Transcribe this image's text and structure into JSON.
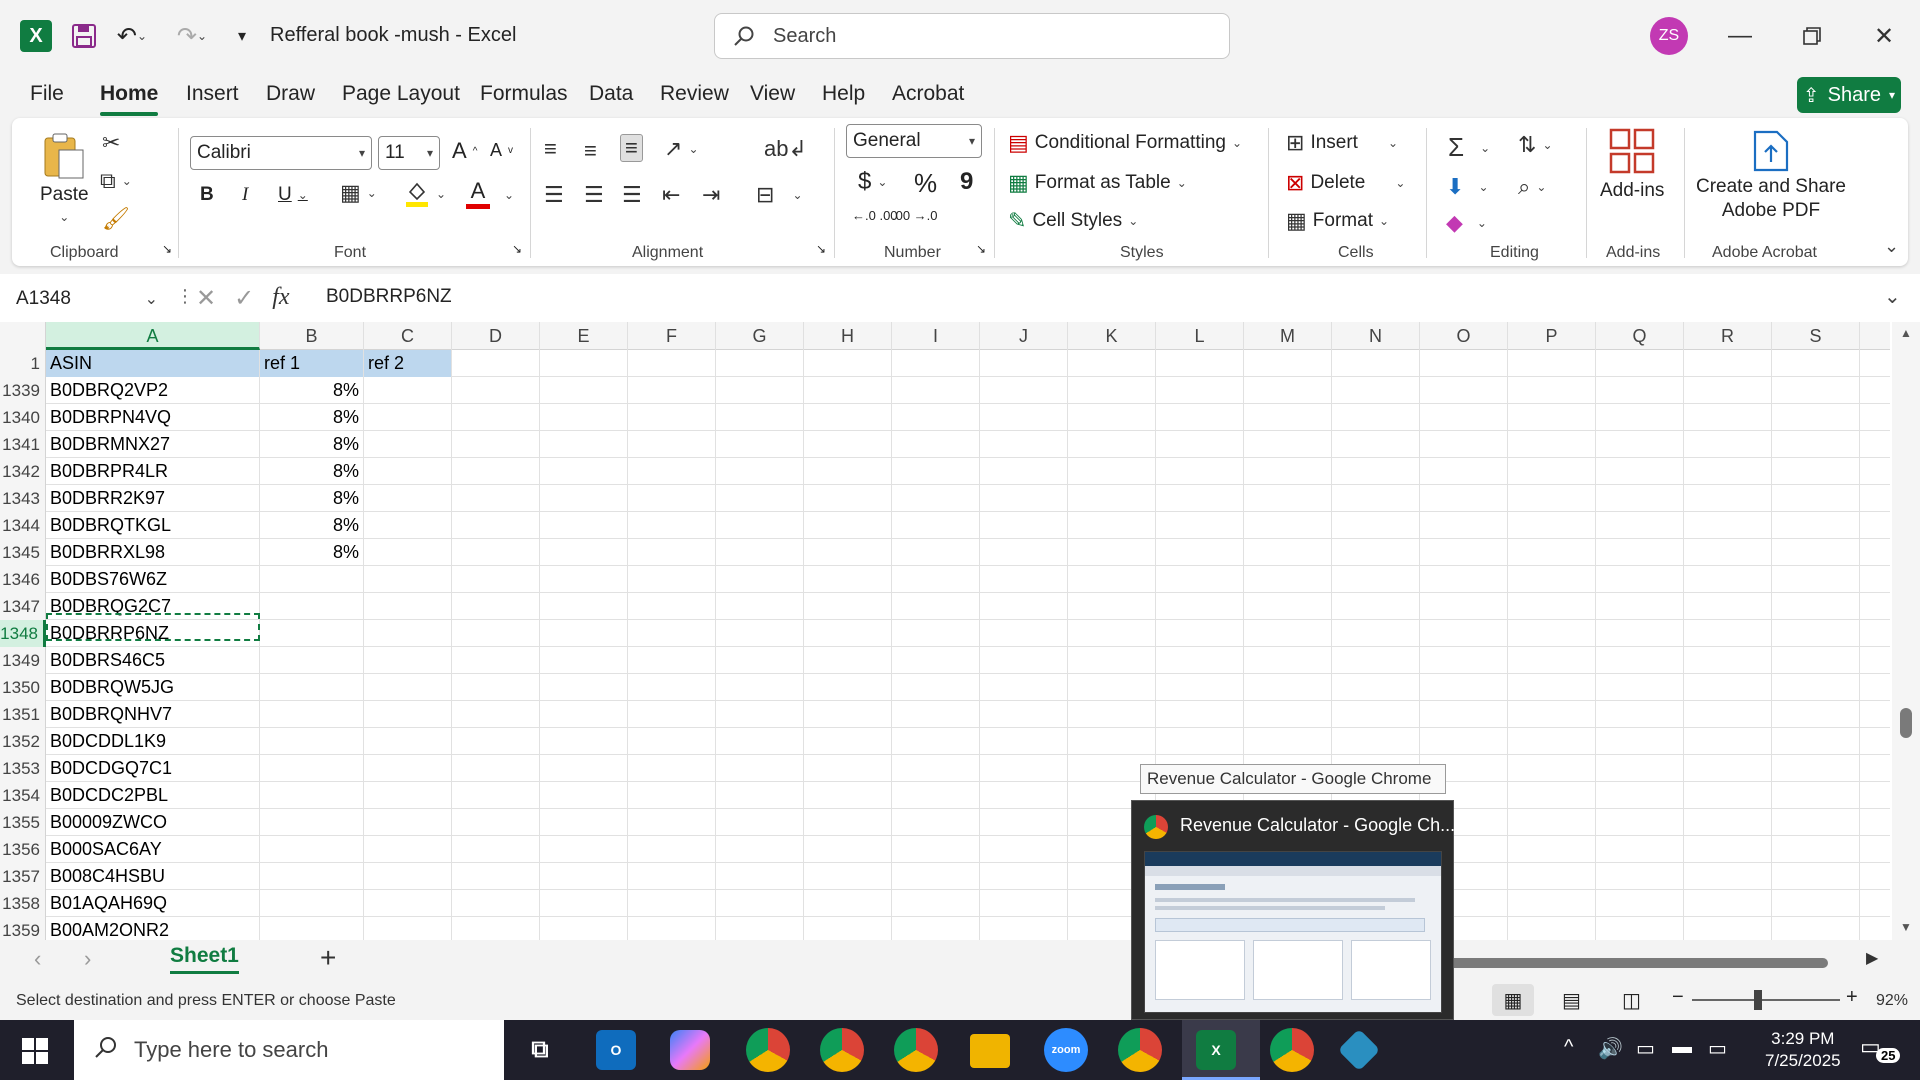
{
  "app": {
    "title": "Refferal book -mush  -  Excel",
    "search_label": "Search",
    "avatar_initials": "ZS",
    "accent": "#107c41"
  },
  "menu": {
    "tabs": [
      "File",
      "Home",
      "Insert",
      "Draw",
      "Page Layout",
      "Formulas",
      "Data",
      "Review",
      "View",
      "Help",
      "Acrobat"
    ],
    "active": "Home",
    "share_label": "Share"
  },
  "ribbon": {
    "clipboard": {
      "paste_label": "Paste",
      "group_label": "Clipboard"
    },
    "font": {
      "family": "Calibri",
      "size": "11",
      "bold": "B",
      "italic": "I",
      "underline": "U",
      "group_label": "Font",
      "grow": "A",
      "shrink": "A",
      "fill_letter": "A"
    },
    "alignment": {
      "group_label": "Alignment"
    },
    "number": {
      "format": "General",
      "currency": "$",
      "percent": "%",
      "comma": "9",
      "inc_dec": "←.0 .00",
      "dec_dec": ".00 →.0",
      "group_label": "Number"
    },
    "styles": {
      "conditional": "Conditional Formatting",
      "format_table": "Format as Table",
      "cell_styles": "Cell Styles",
      "group_label": "Styles"
    },
    "cells": {
      "insert": "Insert",
      "delete": "Delete",
      "format": "Format",
      "group_label": "Cells"
    },
    "editing": {
      "group_label": "Editing"
    },
    "addins": {
      "label": "Add-ins",
      "group_label": "Add-ins"
    },
    "acrobat": {
      "label_line1": "Create and Share",
      "label_line2": "Adobe PDF",
      "group_label": "Adobe Acrobat"
    }
  },
  "formula_bar": {
    "name_box": "A1348",
    "fx": "fx",
    "value": "B0DBRRP6NZ"
  },
  "sheet": {
    "columns": [
      "A",
      "B",
      "C",
      "D",
      "E",
      "F",
      "G",
      "H",
      "I",
      "J",
      "K",
      "L",
      "M",
      "N",
      "O",
      "P",
      "Q",
      "R",
      "S"
    ],
    "header_row": {
      "num": "1",
      "a": "ASIN",
      "b": "ref 1",
      "c": "ref 2"
    },
    "rows": [
      {
        "num": "1339",
        "a": "B0DBRQ2VP2",
        "b": "8%"
      },
      {
        "num": "1340",
        "a": "B0DBRPN4VQ",
        "b": "8%"
      },
      {
        "num": "1341",
        "a": "B0DBRMNX27",
        "b": "8%"
      },
      {
        "num": "1342",
        "a": "B0DBRPR4LR",
        "b": "8%"
      },
      {
        "num": "1343",
        "a": "B0DBRR2K97",
        "b": "8%"
      },
      {
        "num": "1344",
        "a": "B0DBRQTKGL",
        "b": "8%"
      },
      {
        "num": "1345",
        "a": "B0DBRRXL98",
        "b": "8%"
      },
      {
        "num": "1346",
        "a": "B0DBS76W6Z",
        "b": ""
      },
      {
        "num": "1347",
        "a": "B0DBRQG2C7",
        "b": ""
      },
      {
        "num": "1348",
        "a": "B0DBRRP6NZ",
        "b": ""
      },
      {
        "num": "1349",
        "a": "B0DBRS46C5",
        "b": ""
      },
      {
        "num": "1350",
        "a": "B0DBRQW5JG",
        "b": ""
      },
      {
        "num": "1351",
        "a": "B0DBRQNHV7",
        "b": ""
      },
      {
        "num": "1352",
        "a": "B0DCDDL1K9",
        "b": ""
      },
      {
        "num": "1353",
        "a": "B0DCDGQ7C1",
        "b": ""
      },
      {
        "num": "1354",
        "a": "B0DCDC2PBL",
        "b": ""
      },
      {
        "num": "1355",
        "a": "B00009ZWCO",
        "b": ""
      },
      {
        "num": "1356",
        "a": "B000SAC6AY",
        "b": ""
      },
      {
        "num": "1357",
        "a": "B008C4HSBU",
        "b": ""
      },
      {
        "num": "1358",
        "a": "B01AQAH69Q",
        "b": ""
      },
      {
        "num": "1359",
        "a": "B00AM2ONR2",
        "b": ""
      }
    ],
    "tab_name": "Sheet1",
    "add_sheet": "+"
  },
  "status": {
    "text": "Select destination and press ENTER or choose Paste",
    "zoom": "92%"
  },
  "preview": {
    "tooltip": "Revenue Calculator - Google Chrome",
    "title": "Revenue Calculator - Google Ch..."
  },
  "taskbar": {
    "search_placeholder": "Type here to search",
    "time": "3:29 PM",
    "date": "7/25/2025",
    "notif_count": "25"
  }
}
